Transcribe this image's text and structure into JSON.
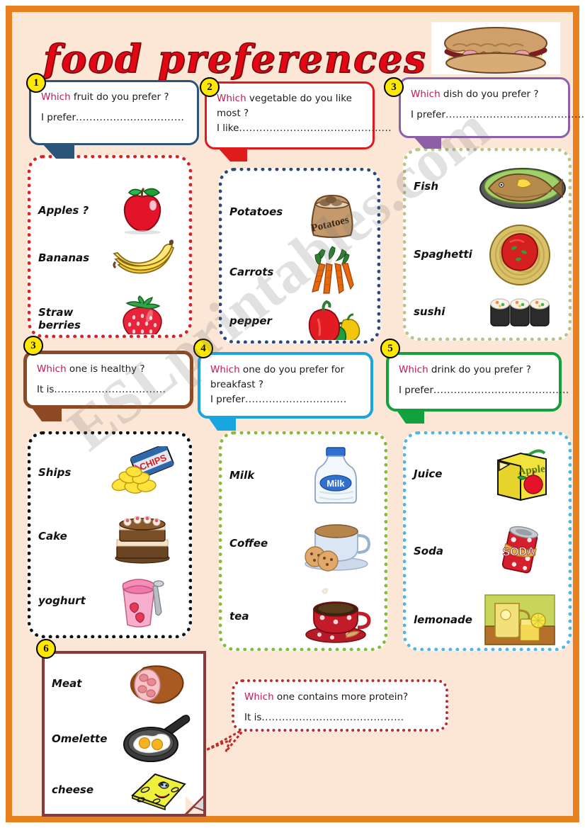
{
  "page": {
    "title": "food preferences",
    "watermark": "ESLprintables.com",
    "frame_color": "#e8801f",
    "background_color": "#fce6d5"
  },
  "header_image": {
    "name": "sandwich-clipart",
    "alt": "sandwich"
  },
  "bubbles": [
    {
      "number": "1",
      "border_color": "#2c5478",
      "which": "Which",
      "question_rest": " fruit do you prefer ?",
      "answer_prefix": "I prefer",
      "answer_dots": "................................"
    },
    {
      "number": "2",
      "border_color": "#e01b1b",
      "which": "Which",
      "question_rest": " vegetable do you like",
      "question_line2": "most ?",
      "answer_prefix": "I like",
      "answer_dots": "............................................."
    },
    {
      "number": "3",
      "border_color": "#8d5fa8",
      "which": "Which",
      "question_rest": " dish do you prefer ?",
      "answer_prefix": "I prefer",
      "answer_dots": "........................................."
    },
    {
      "number": "3",
      "border_color": "#8c4a24",
      "which": "Which",
      "question_rest": " one is healthy ?",
      "answer_prefix": "It is",
      "answer_dots": "................................."
    },
    {
      "number": "4",
      "border_color": "#17a6e0",
      "which": "Which",
      "question_rest": " one do you prefer for",
      "question_line2": "breakfast ?",
      "answer_prefix": "I  prefer",
      "answer_dots": ".............................."
    },
    {
      "number": "5",
      "border_color": "#12a13c",
      "which": "Which",
      "question_rest": " drink do you prefer ?",
      "answer_prefix": "I prefer",
      "answer_dots": "........................................"
    },
    {
      "number": "",
      "border_color": "#c12a2a",
      "which": "Which",
      "question_rest": "  one  contains more protein?",
      "answer_prefix": "It is",
      "answer_dots": ".........................................."
    }
  ],
  "cards": [
    {
      "id": "fruit",
      "border_color": "#e02020",
      "items": [
        {
          "label": "Apples ?",
          "icon": "apple-icon"
        },
        {
          "label": "Bananas",
          "icon": "banana-icon"
        },
        {
          "label": "Straw  berries",
          "icon": "strawberry-icon"
        }
      ]
    },
    {
      "id": "vegetables",
      "border_color": "#2c4a78",
      "items": [
        {
          "label": "Potatoes",
          "icon": "potato-sack-icon"
        },
        {
          "label": "Carrots",
          "icon": "carrots-icon"
        },
        {
          "label": "pepper",
          "icon": "peppers-icon"
        }
      ]
    },
    {
      "id": "dishes",
      "border_color": "#b7c48a",
      "items": [
        {
          "label": "Fish",
          "icon": "fish-plate-icon"
        },
        {
          "label": "Spaghetti",
          "icon": "spaghetti-icon"
        },
        {
          "label": "sushi",
          "icon": "sushi-icon"
        }
      ]
    },
    {
      "id": "snacks",
      "border_color": "#111111",
      "items": [
        {
          "label": "Ships",
          "icon": "chips-icon"
        },
        {
          "label": "Cake",
          "icon": "cake-icon"
        },
        {
          "label": "yoghurt",
          "icon": "yoghurt-icon"
        }
      ]
    },
    {
      "id": "breakfast",
      "border_color": "#86bb3c",
      "items": [
        {
          "label": "Milk",
          "icon": "milk-bottle-icon"
        },
        {
          "label": "Coffee",
          "icon": "coffee-cup-icon"
        },
        {
          "label": "tea",
          "icon": "tea-cup-icon"
        }
      ]
    },
    {
      "id": "drinks",
      "border_color": "#4fb6e8",
      "items": [
        {
          "label": "Juice",
          "icon": "juice-box-icon"
        },
        {
          "label": "Soda",
          "icon": "soda-can-icon"
        },
        {
          "label": "lemonade",
          "icon": "lemonade-icon"
        }
      ]
    },
    {
      "id": "protein",
      "border_color": "#8b3a3a",
      "items": [
        {
          "label": "Meat",
          "icon": "ham-icon"
        },
        {
          "label": "Omelette",
          "icon": "fried-eggs-pan-icon"
        },
        {
          "label": "cheese",
          "icon": "cheese-icon"
        }
      ]
    }
  ],
  "badges": [
    "1",
    "2",
    "3",
    "3",
    "4",
    "5",
    "6"
  ]
}
